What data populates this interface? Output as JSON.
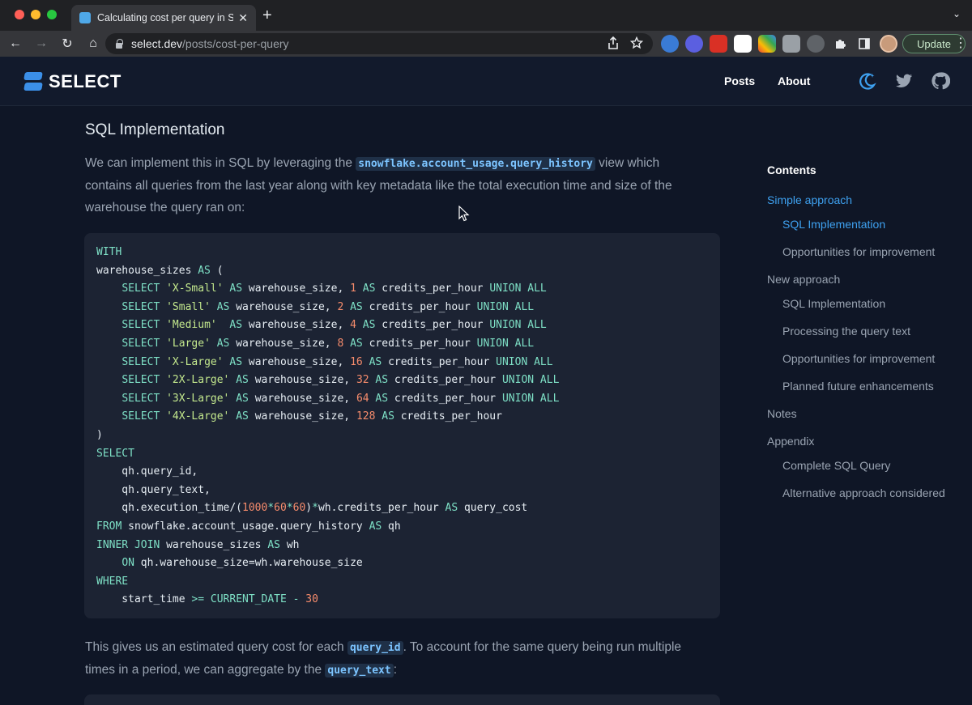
{
  "browser": {
    "tab_title": "Calculating cost per query in Snowflake",
    "tab_close": "✕",
    "new_tab": "+",
    "tab_search": "⌄",
    "nav": {
      "back": "←",
      "forward": "→",
      "reload": "↻",
      "home": "⌂"
    },
    "url_host": "select.dev",
    "url_path": "/posts/cost-per-query",
    "update_label": "Update",
    "menu": "⋮"
  },
  "site": {
    "logo_text": "SELECT",
    "nav": {
      "posts": "Posts",
      "about": "About"
    },
    "accent": "#3ea1f0"
  },
  "article": {
    "section_title": "SQL Implementation",
    "p1_before": "We can implement this in SQL by leveraging the ",
    "p1_code": "snowflake.account_usage.query_history",
    "p1_after": " view which contains all queries from the last year along with key metadata like the total execution time and size of the warehouse the query ran on:",
    "p2_before": "This gives us an estimated query cost for each ",
    "p2_code1": "query_id",
    "p2_middle": ". To account for the same query being run multiple times in a period, we can aggregate by the ",
    "p2_code2": "query_text",
    "p2_after": ":"
  },
  "code_lines": [
    [
      [
        "kw",
        "WITH"
      ]
    ],
    [
      [
        "t",
        "warehouse_sizes "
      ],
      [
        "kw",
        "AS"
      ],
      [
        "t",
        " ("
      ]
    ],
    [
      [
        "t",
        "    "
      ],
      [
        "kw",
        "SELECT"
      ],
      [
        "t",
        " "
      ],
      [
        "str",
        "'X-Small'"
      ],
      [
        "t",
        " "
      ],
      [
        "kw",
        "AS"
      ],
      [
        "t",
        " warehouse_size, "
      ],
      [
        "num",
        "1"
      ],
      [
        "t",
        " "
      ],
      [
        "kw",
        "AS"
      ],
      [
        "t",
        " credits_per_hour "
      ],
      [
        "kw",
        "UNION ALL"
      ]
    ],
    [
      [
        "t",
        "    "
      ],
      [
        "kw",
        "SELECT"
      ],
      [
        "t",
        " "
      ],
      [
        "str",
        "'Small'"
      ],
      [
        "t",
        " "
      ],
      [
        "kw",
        "AS"
      ],
      [
        "t",
        " warehouse_size, "
      ],
      [
        "num",
        "2"
      ],
      [
        "t",
        " "
      ],
      [
        "kw",
        "AS"
      ],
      [
        "t",
        " credits_per_hour "
      ],
      [
        "kw",
        "UNION ALL"
      ]
    ],
    [
      [
        "t",
        "    "
      ],
      [
        "kw",
        "SELECT"
      ],
      [
        "t",
        " "
      ],
      [
        "str",
        "'Medium'"
      ],
      [
        "t",
        "  "
      ],
      [
        "kw",
        "AS"
      ],
      [
        "t",
        " warehouse_size, "
      ],
      [
        "num",
        "4"
      ],
      [
        "t",
        " "
      ],
      [
        "kw",
        "AS"
      ],
      [
        "t",
        " credits_per_hour "
      ],
      [
        "kw",
        "UNION ALL"
      ]
    ],
    [
      [
        "t",
        "    "
      ],
      [
        "kw",
        "SELECT"
      ],
      [
        "t",
        " "
      ],
      [
        "str",
        "'Large'"
      ],
      [
        "t",
        " "
      ],
      [
        "kw",
        "AS"
      ],
      [
        "t",
        " warehouse_size, "
      ],
      [
        "num",
        "8"
      ],
      [
        "t",
        " "
      ],
      [
        "kw",
        "AS"
      ],
      [
        "t",
        " credits_per_hour "
      ],
      [
        "kw",
        "UNION ALL"
      ]
    ],
    [
      [
        "t",
        "    "
      ],
      [
        "kw",
        "SELECT"
      ],
      [
        "t",
        " "
      ],
      [
        "str",
        "'X-Large'"
      ],
      [
        "t",
        " "
      ],
      [
        "kw",
        "AS"
      ],
      [
        "t",
        " warehouse_size, "
      ],
      [
        "num",
        "16"
      ],
      [
        "t",
        " "
      ],
      [
        "kw",
        "AS"
      ],
      [
        "t",
        " credits_per_hour "
      ],
      [
        "kw",
        "UNION ALL"
      ]
    ],
    [
      [
        "t",
        "    "
      ],
      [
        "kw",
        "SELECT"
      ],
      [
        "t",
        " "
      ],
      [
        "str",
        "'2X-Large'"
      ],
      [
        "t",
        " "
      ],
      [
        "kw",
        "AS"
      ],
      [
        "t",
        " warehouse_size, "
      ],
      [
        "num",
        "32"
      ],
      [
        "t",
        " "
      ],
      [
        "kw",
        "AS"
      ],
      [
        "t",
        " credits_per_hour "
      ],
      [
        "kw",
        "UNION ALL"
      ]
    ],
    [
      [
        "t",
        "    "
      ],
      [
        "kw",
        "SELECT"
      ],
      [
        "t",
        " "
      ],
      [
        "str",
        "'3X-Large'"
      ],
      [
        "t",
        " "
      ],
      [
        "kw",
        "AS"
      ],
      [
        "t",
        " warehouse_size, "
      ],
      [
        "num",
        "64"
      ],
      [
        "t",
        " "
      ],
      [
        "kw",
        "AS"
      ],
      [
        "t",
        " credits_per_hour "
      ],
      [
        "kw",
        "UNION ALL"
      ]
    ],
    [
      [
        "t",
        "    "
      ],
      [
        "kw",
        "SELECT"
      ],
      [
        "t",
        " "
      ],
      [
        "str",
        "'4X-Large'"
      ],
      [
        "t",
        " "
      ],
      [
        "kw",
        "AS"
      ],
      [
        "t",
        " warehouse_size, "
      ],
      [
        "num",
        "128"
      ],
      [
        "t",
        " "
      ],
      [
        "kw",
        "AS"
      ],
      [
        "t",
        " credits_per_hour"
      ]
    ],
    [
      [
        "t",
        ")"
      ]
    ],
    [
      [
        "kw",
        "SELECT"
      ]
    ],
    [
      [
        "t",
        "    qh.query_id,"
      ]
    ],
    [
      [
        "t",
        "    qh.query_text,"
      ]
    ],
    [
      [
        "t",
        "    qh.execution_time/("
      ],
      [
        "num",
        "1000"
      ],
      [
        "op",
        "*"
      ],
      [
        "num",
        "60"
      ],
      [
        "op",
        "*"
      ],
      [
        "num",
        "60"
      ],
      [
        "t",
        ")"
      ],
      [
        "op",
        "*"
      ],
      [
        "t",
        "wh.credits_per_hour "
      ],
      [
        "kw",
        "AS"
      ],
      [
        "t",
        " query_cost"
      ]
    ],
    [
      [
        "kw",
        "FROM"
      ],
      [
        "t",
        " snowflake.account_usage.query_history "
      ],
      [
        "kw",
        "AS"
      ],
      [
        "t",
        " qh"
      ]
    ],
    [
      [
        "kw",
        "INNER JOIN"
      ],
      [
        "t",
        " warehouse_sizes "
      ],
      [
        "kw",
        "AS"
      ],
      [
        "t",
        " wh"
      ]
    ],
    [
      [
        "t",
        "    "
      ],
      [
        "kw",
        "ON"
      ],
      [
        "t",
        " qh.warehouse_size=wh.warehouse_size"
      ]
    ],
    [
      [
        "kw",
        "WHERE"
      ]
    ],
    [
      [
        "t",
        "    start_time "
      ],
      [
        "op",
        ">="
      ],
      [
        "t",
        " "
      ],
      [
        "kw",
        "CURRENT_DATE"
      ],
      [
        "t",
        " "
      ],
      [
        "op",
        "-"
      ],
      [
        "t",
        " "
      ],
      [
        "num",
        "30"
      ]
    ]
  ],
  "toc": {
    "title": "Contents",
    "items": [
      {
        "label": "Simple approach",
        "level": 1,
        "active": true
      },
      {
        "label": "SQL Implementation",
        "level": 2,
        "active": true
      },
      {
        "label": "Opportunities for improvement",
        "level": 2,
        "active": false
      },
      {
        "label": "New approach",
        "level": 1,
        "active": false
      },
      {
        "label": "SQL Implementation",
        "level": 2,
        "active": false
      },
      {
        "label": "Processing the query text",
        "level": 2,
        "active": false
      },
      {
        "label": "Opportunities for improvement",
        "level": 2,
        "active": false
      },
      {
        "label": "Planned future enhancements",
        "level": 2,
        "active": false
      },
      {
        "label": "Notes",
        "level": 1,
        "active": false
      },
      {
        "label": "Appendix",
        "level": 1,
        "active": false
      },
      {
        "label": "Complete SQL Query",
        "level": 2,
        "active": false
      },
      {
        "label": "Alternative approach considered",
        "level": 2,
        "active": false
      }
    ]
  },
  "icons": {
    "header": [
      "theme-toggle-icon",
      "twitter-icon",
      "github-icon"
    ],
    "toolbar": [
      "share-icon",
      "bookmark-star-icon"
    ]
  }
}
